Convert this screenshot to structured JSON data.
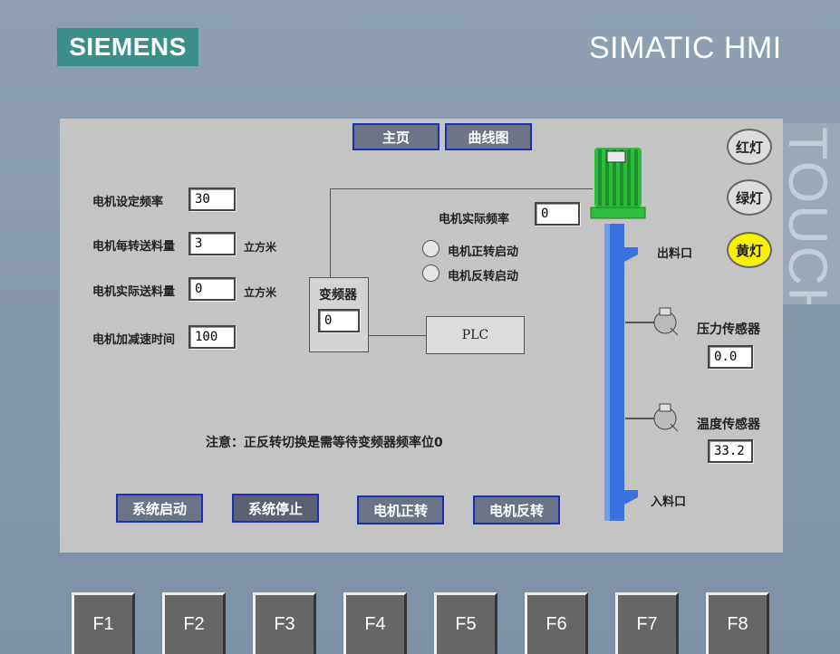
{
  "bezel": {
    "logo": "SIEMENS",
    "brand": "SIMATIC HMI",
    "touch": "TOUCH"
  },
  "nav": {
    "home": "主页",
    "curve": "曲线图"
  },
  "params": {
    "set_freq_label": "电机设定频率",
    "set_freq_value": "30",
    "feed_per_rev_label": "电机每转送料量",
    "feed_per_rev_value": "3",
    "feed_per_rev_unit": "立方米",
    "actual_feed_label": "电机实际送料量",
    "actual_feed_value": "0",
    "actual_feed_unit": "立方米",
    "accel_time_label": "电机加减速时间",
    "accel_time_value": "100"
  },
  "vfd": {
    "label": "变频器",
    "value": "0"
  },
  "plc": {
    "label": "PLC"
  },
  "motor": {
    "actual_freq_label": "电机实际频率",
    "actual_freq_value": "0",
    "forward_indicator_label": "电机正转启动",
    "reverse_indicator_label": "电机反转启动"
  },
  "lamps": {
    "red": "红灯",
    "green": "绿灯",
    "yellow": "黄灯",
    "yellow_color": "#f7f000"
  },
  "pipe": {
    "outlet": "出料口",
    "inlet": "入料口",
    "pipe_color": "#3a73e0",
    "motor_color": "#2bbf3b"
  },
  "sensors": {
    "pressure_label": "压力传感器",
    "pressure_value": "0.0",
    "temperature_label": "温度传感器",
    "temperature_value": "33.2"
  },
  "note": "注意：正反转切换是需等待变频器频率位0",
  "buttons": {
    "system_start": "系统启动",
    "system_stop": "系统停止",
    "motor_forward": "电机正转",
    "motor_reverse": "电机反转"
  },
  "function_keys": [
    "F1",
    "F2",
    "F3",
    "F4",
    "F5",
    "F6",
    "F7",
    "F8"
  ]
}
